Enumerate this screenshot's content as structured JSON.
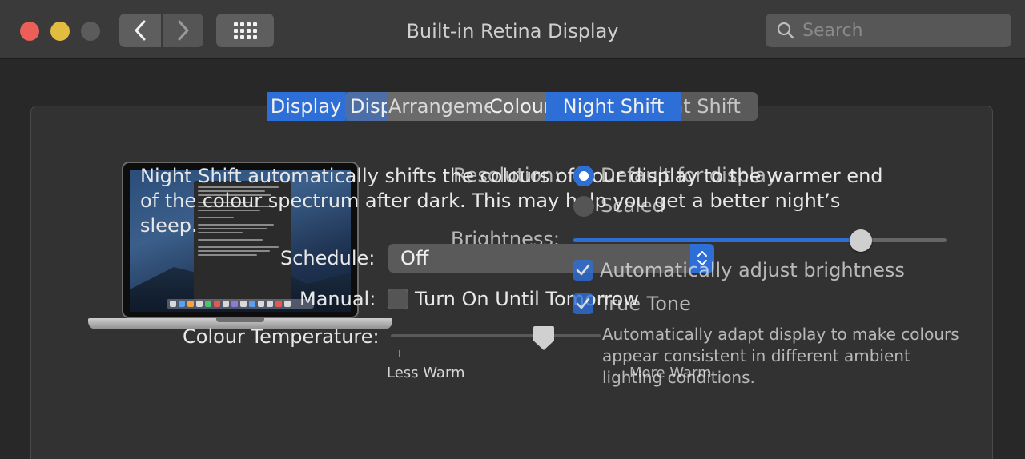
{
  "window": {
    "title": "Built-in Retina Display"
  },
  "toolbar": {
    "back_icon": "chevron-left-icon",
    "forward_icon": "chevron-right-icon",
    "grid_icon": "grid-icon"
  },
  "search": {
    "placeholder": "Search"
  },
  "tabs": {
    "front": [
      {
        "label": "Display",
        "selected": true
      },
      {
        "label": "Display",
        "selected": false
      },
      {
        "label": "Arrangement",
        "selected": false
      },
      {
        "label": "Colour",
        "selected": false
      }
    ],
    "night_shift": "Night Shift",
    "ghost_right": "nt Shift"
  },
  "night_shift": {
    "description": "Night Shift automatically shifts the colours of your display to the warmer end of the colour spectrum after dark. This may help you get a better night’s sleep.",
    "schedule_label": "Schedule:",
    "schedule_value": "Off",
    "manual_label": "Manual:",
    "manual_checkbox_label": "Turn On Until Tomorrow",
    "manual_checked": false,
    "temperature_label": "Colour Temperature:",
    "temperature_level": 0.73,
    "less_warm": "Less Warm",
    "more_warm": "More Warm"
  },
  "display": {
    "resolution_label": "Resolution:",
    "option_default": "Default for display",
    "option_scaled": "Scaled",
    "selected_option": "Default for display",
    "brightness_label": "Brightness:",
    "brightness_level": 0.77,
    "auto_brightness_label": "Automatically adjust brightness",
    "auto_brightness_checked": true,
    "true_tone_label": "True Tone",
    "true_tone_checked": true,
    "true_tone_description": "Automatically adapt display to make colours appear consistent in different ambient lighting conditions."
  },
  "colors": {
    "accent": "#2e6fd7",
    "close": "#ec5f58",
    "minimize": "#e1bc3f"
  }
}
